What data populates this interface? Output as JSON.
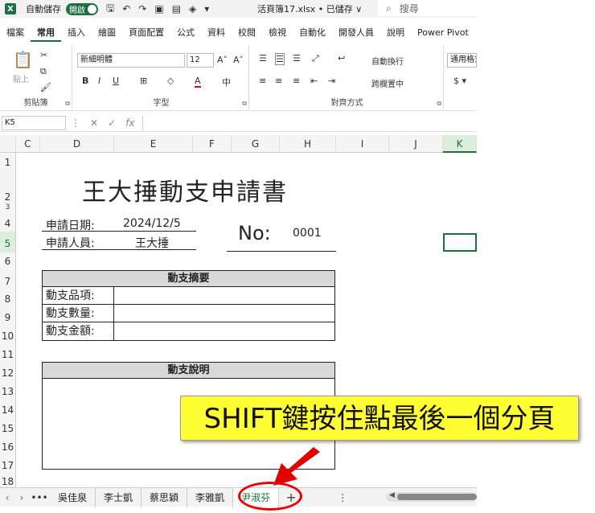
{
  "titlebar": {
    "logo": "X",
    "autosave_label": "自動儲存",
    "toggle_label": "開啟",
    "filename": "活頁簿17.xlsx • 已儲存 ∨",
    "search_placeholder": "搜尋"
  },
  "menu": {
    "tabs": [
      "檔案",
      "常用",
      "插入",
      "繪圖",
      "頁面配置",
      "公式",
      "資料",
      "校閱",
      "檢視",
      "自動化",
      "開發人員",
      "說明",
      "Power Pivot"
    ]
  },
  "ribbon": {
    "paste_label": "貼上",
    "font_name": "新細明體",
    "font_size": "12",
    "wrap_text": "自動換行",
    "merge_center": "跨欄置中",
    "number_format": "通用格式",
    "group_clipboard": "剪貼簿",
    "group_font": "字型",
    "group_alignment": "對齊方式"
  },
  "formulabar": {
    "namebox": "K5",
    "fx": "fx"
  },
  "columns": [
    "C",
    "D",
    "E",
    "F",
    "G",
    "H",
    "I",
    "J",
    "K"
  ],
  "rows": [
    "1",
    "2",
    "3",
    "4",
    "5",
    "6",
    "7",
    "8",
    "9",
    "10",
    "11",
    "12",
    "13",
    "14",
    "15",
    "16",
    "17",
    "18"
  ],
  "form": {
    "title": "王大捶動支申請書",
    "apply_date_label": "申請日期:",
    "apply_date_value": "2024/12/5",
    "applicant_label": "申請人員:",
    "applicant_value": "王大捶",
    "no_label": "No:",
    "no_value": "0001",
    "summary_header": "動支摘要",
    "summary_rows": [
      "動支品項:",
      "動支數量:",
      "動支金額:"
    ],
    "desc_header": "動支說明"
  },
  "callout": "SHIFT鍵按住點最後一個分頁",
  "sheets": {
    "tabs": [
      "吳佳泉",
      "李士凱",
      "蔡思穎",
      "李雅凱",
      "尹淑芬"
    ],
    "active": "尹淑芬",
    "more": "•••",
    "add": "+"
  },
  "colors": {
    "excel_green": "#1d6f42",
    "callout_bg": "#ffff33",
    "highlight_red": "#e00000"
  }
}
